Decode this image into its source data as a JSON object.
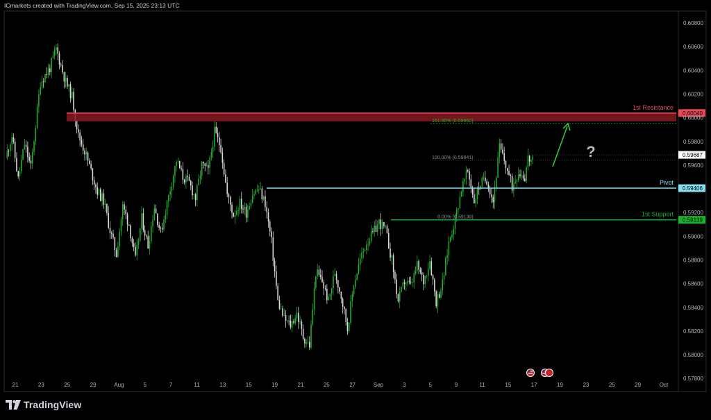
{
  "header": {
    "caption": "ICmarkets created with TradingView.com, Sep 15, 2025 23:13 UTC"
  },
  "brand": {
    "name": "TradingView",
    "icon": "tradingview-logo-icon"
  },
  "colors": {
    "up": "#22ab2e",
    "down": "#d8d8d8",
    "resistance": "#e84a55",
    "support": "#19b22b",
    "pivot": "#86e0f0",
    "fib": "#8a8f98",
    "arrow": "#2fc43c",
    "question": "#b8b8b8",
    "price_box_bg": "#ffffff",
    "grid_border": "#2a2e39"
  },
  "chart_data": {
    "type": "candlestick",
    "symbol_interval": "4H",
    "y_axis": {
      "ylim": [
        0.5769,
        0.609
      ],
      "ticks": [
        "0.60800",
        "0.60600",
        "0.60400",
        "0.60200",
        "0.60000",
        "0.59800",
        "0.59600",
        "0.59200",
        "0.59000",
        "0.58800",
        "0.58600",
        "0.58400",
        "0.58200",
        "0.58000",
        "0.57800"
      ]
    },
    "x_axis": {
      "ticks": [
        "21",
        "23",
        "25",
        "29",
        "Aug",
        "5",
        "7",
        "11",
        "13",
        "15",
        "19",
        "21",
        "25",
        "27",
        "Sep",
        "3",
        "5",
        "9",
        "11",
        "15",
        "17",
        "19",
        "23",
        "25",
        "29",
        "Oct"
      ]
    },
    "price_path": [
      [
        0,
        0.5966
      ],
      [
        4,
        0.5985
      ],
      [
        8,
        0.5948
      ],
      [
        12,
        0.5978
      ],
      [
        16,
        0.5958
      ],
      [
        22,
        0.603
      ],
      [
        28,
        0.6042
      ],
      [
        32,
        0.6058
      ],
      [
        38,
        0.603
      ],
      [
        42,
        0.6018
      ],
      [
        46,
        0.5985
      ],
      [
        50,
        0.5972
      ],
      [
        54,
        0.5955
      ],
      [
        58,
        0.5938
      ],
      [
        62,
        0.593
      ],
      [
        66,
        0.5905
      ],
      [
        70,
        0.5885
      ],
      [
        74,
        0.5925
      ],
      [
        78,
        0.591
      ],
      [
        82,
        0.588
      ],
      [
        86,
        0.5915
      ],
      [
        90,
        0.5892
      ],
      [
        94,
        0.5925
      ],
      [
        98,
        0.5903
      ],
      [
        104,
        0.594
      ],
      [
        108,
        0.5964
      ],
      [
        112,
        0.595
      ],
      [
        116,
        0.5945
      ],
      [
        120,
        0.5932
      ],
      [
        124,
        0.596
      ],
      [
        128,
        0.5955
      ],
      [
        132,
        0.5988
      ],
      [
        136,
        0.5975
      ],
      [
        140,
        0.5935
      ],
      [
        144,
        0.5918
      ],
      [
        148,
        0.5928
      ],
      [
        152,
        0.592
      ],
      [
        156,
        0.5936
      ],
      [
        160,
        0.594
      ],
      [
        164,
        0.5928
      ],
      [
        168,
        0.5895
      ],
      [
        172,
        0.5845
      ],
      [
        176,
        0.583
      ],
      [
        180,
        0.5825
      ],
      [
        184,
        0.5835
      ],
      [
        188,
        0.5815
      ],
      [
        192,
        0.5808
      ],
      [
        196,
        0.587
      ],
      [
        200,
        0.5862
      ],
      [
        204,
        0.5845
      ],
      [
        208,
        0.587
      ],
      [
        212,
        0.585
      ],
      [
        216,
        0.5822
      ],
      [
        220,
        0.586
      ],
      [
        224,
        0.588
      ],
      [
        228,
        0.5895
      ],
      [
        232,
        0.5902
      ],
      [
        236,
        0.5912
      ],
      [
        240,
        0.5905
      ],
      [
        244,
        0.588
      ],
      [
        248,
        0.5845
      ],
      [
        252,
        0.5862
      ],
      [
        256,
        0.5858
      ],
      [
        260,
        0.5875
      ],
      [
        264,
        0.5862
      ],
      [
        268,
        0.588
      ],
      [
        272,
        0.5845
      ],
      [
        276,
        0.586
      ],
      [
        280,
        0.5895
      ],
      [
        284,
        0.5915
      ],
      [
        288,
        0.594
      ],
      [
        292,
        0.5955
      ],
      [
        296,
        0.593
      ],
      [
        300,
        0.5945
      ],
      [
        304,
        0.5948
      ],
      [
        308,
        0.593
      ],
      [
        312,
        0.5975
      ],
      [
        316,
        0.596
      ],
      [
        320,
        0.5942
      ],
      [
        324,
        0.5955
      ],
      [
        328,
        0.595
      ],
      [
        330,
        0.5966
      ],
      [
        333,
        0.5963
      ]
    ],
    "levels": [
      {
        "name": "1st Resistance",
        "price_label": "0.60040",
        "value": 0.6004,
        "kind": "zone",
        "zone_low": 0.5997
      },
      {
        "name": "Pivot",
        "price_label": "0.59406",
        "value": 0.59406,
        "kind": "line"
      },
      {
        "name": "1st Support",
        "price_label": "0.59139",
        "value": 0.59139,
        "kind": "line"
      }
    ],
    "current_price": {
      "label": "0.59687",
      "value": 0.59687
    },
    "fib_labels": [
      {
        "text": "161.80% (0.59952)",
        "value": 0.59952
      },
      {
        "text": "100.00% (0.59641)",
        "value": 0.59641
      },
      {
        "text": "0.00% (0.59139)",
        "value": 0.59139
      }
    ],
    "annotation": {
      "arrow": "up",
      "question_mark": "?"
    },
    "event_icons": [
      "us-flag-icon",
      "us-flag-icon"
    ]
  }
}
